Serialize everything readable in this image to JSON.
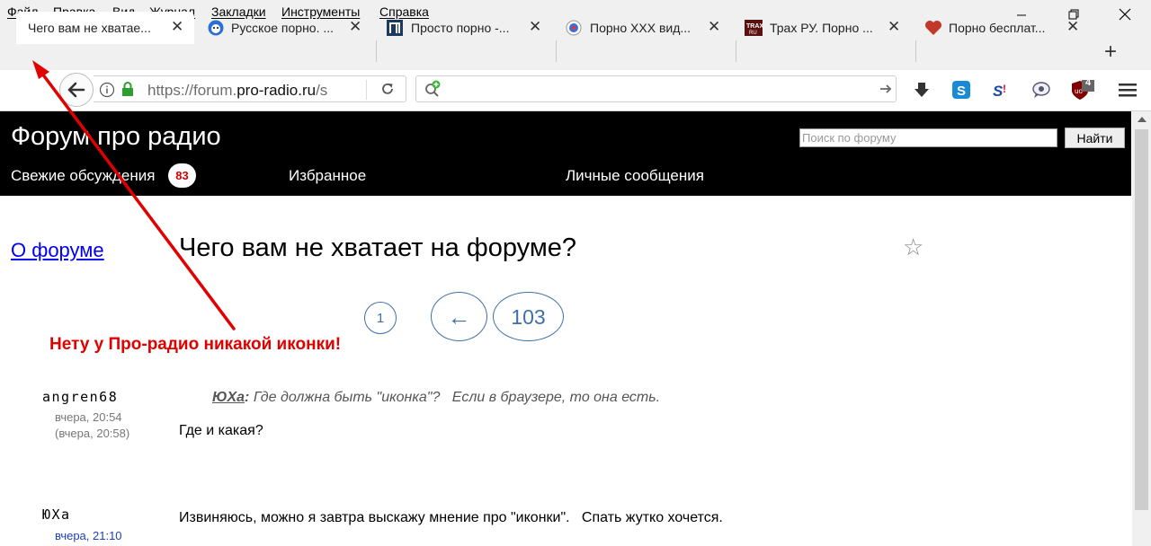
{
  "menubar": {
    "items": [
      "Файл",
      "Правка",
      "Вид",
      "Журнал",
      "Закладки",
      "Инструменты",
      "Справка"
    ]
  },
  "tabs": [
    {
      "title": "Чего вам не хватае...",
      "active": true
    },
    {
      "title": "Русское порно. ...",
      "icon": "bear-icon"
    },
    {
      "title": "Просто порно -...",
      "icon": "pi-icon"
    },
    {
      "title": "Порно XXX вид...",
      "icon": "circle-icon"
    },
    {
      "title": "Трах РУ. Порно ...",
      "icon": "trah-icon"
    },
    {
      "title": "Порно бесплат...",
      "icon": "heart-icon"
    }
  ],
  "navbar": {
    "url_prefix": "https://forum.",
    "url_domain": "pro-radio.ru",
    "url_suffix": "/s",
    "ublock_count": "4"
  },
  "header": {
    "site_title": "Форум про радио",
    "search_placeholder": "Поиск по форуму",
    "search_button": "Найти",
    "nav": {
      "fresh": "Свежие обсуждения",
      "fresh_count": "83",
      "favorites": "Избранное",
      "messages": "Личные сообщения"
    }
  },
  "sidebar": {
    "about": "О форуме"
  },
  "thread": {
    "title": "Чего вам не хватает на форуме?",
    "pager": {
      "first": "1",
      "prev": "←",
      "last": "103"
    }
  },
  "annotation": "Нету у Про-радио никакой иконки!",
  "posts": [
    {
      "author": "angren68",
      "time": "вчера, 20:54",
      "edited": "(вчера, 20:58)",
      "quote_author": "ЮХа",
      "quote": "Где должна быть \"иконка\"?   Если в браузере, то она есть.",
      "body": "Где и какая?"
    },
    {
      "author": "ЮХа",
      "time": "вчера, 21:10",
      "body": "Извиняюсь, можно я завтра выскажу мнение про \"иконки\".   Спать жутко хочется."
    }
  ],
  "colors": {
    "header_bg": "#000000",
    "badge_text": "#d00000",
    "link": "#0000ee",
    "pager": "#3f70a8",
    "annotation": "#e00000"
  }
}
